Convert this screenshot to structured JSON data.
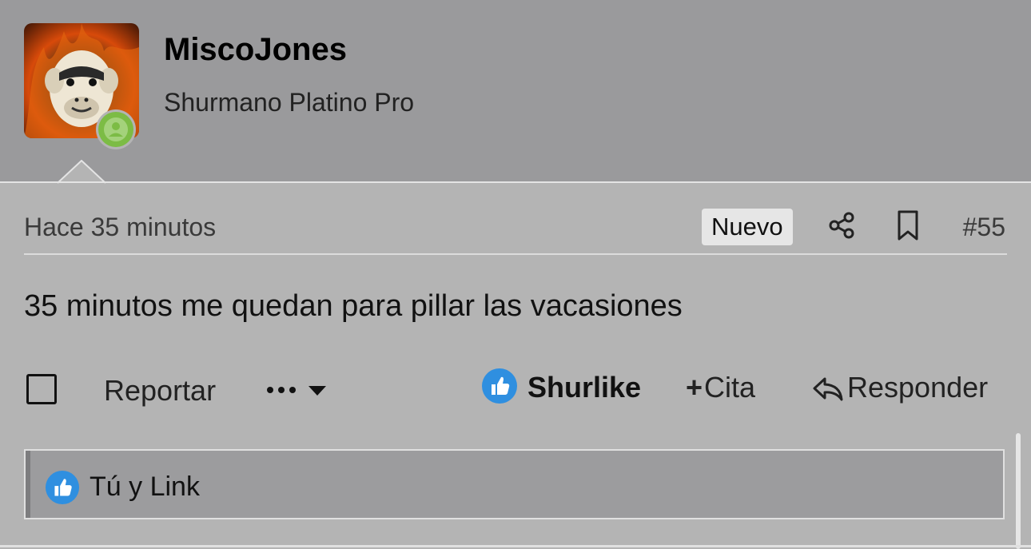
{
  "user": {
    "name": "MiscoJones",
    "title": "Shurmano Platino Pro",
    "status": "online",
    "status_color": "#7cbc45"
  },
  "post": {
    "time": "Hace 35 minutos",
    "badge": "Nuevo",
    "number": "#55",
    "body": "35 minutos me quedan para pillar las vacasiones"
  },
  "actions": {
    "report": "Reportar",
    "more": "more-options-icon",
    "like": "Shurlike",
    "quote": "Cita",
    "quote_prefix": "+",
    "reply": "Responder"
  },
  "likes": {
    "text": "Tú y Link"
  },
  "colors": {
    "header_bg": "#9a9a9c",
    "body_bg": "#b4b4b4",
    "like_blue": "#2f8fe0"
  }
}
